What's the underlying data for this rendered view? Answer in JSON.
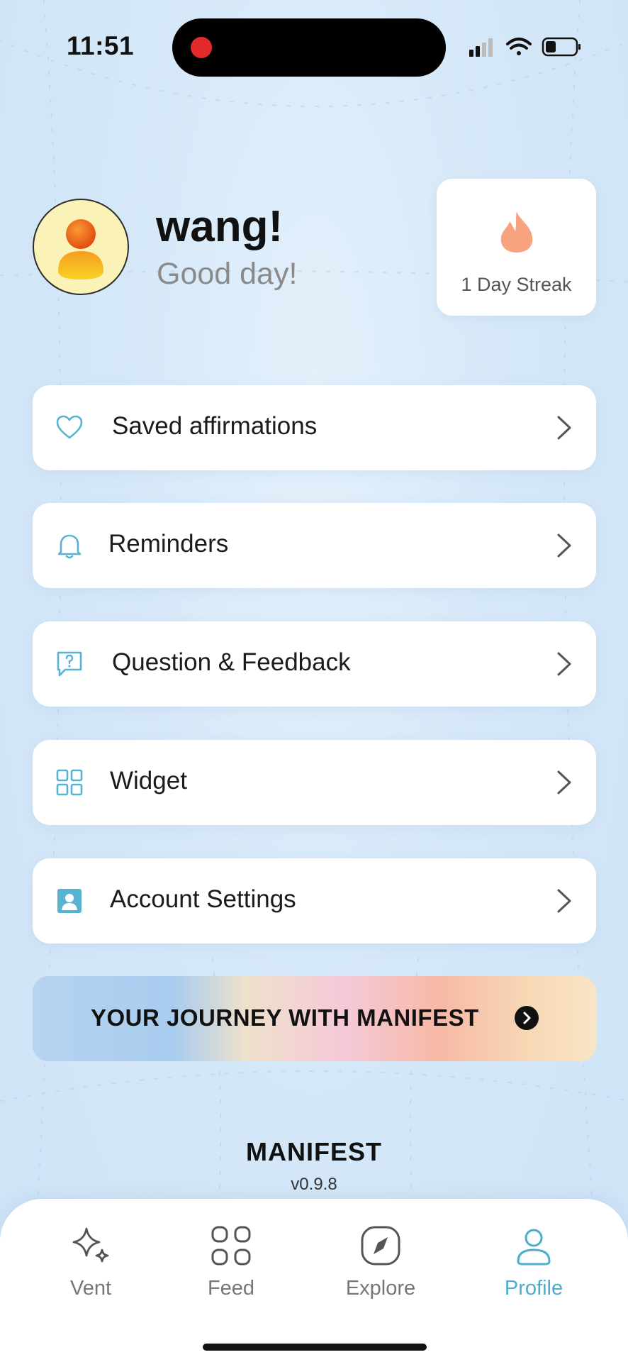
{
  "status_bar": {
    "time": "11:51"
  },
  "profile": {
    "username": "wang!",
    "greeting": "Good day!",
    "streak_label": "1 Day Streak"
  },
  "menu": [
    {
      "label": "Saved affirmations",
      "icon": "heart-icon"
    },
    {
      "label": "Reminders",
      "icon": "bell-icon"
    },
    {
      "label": "Question & Feedback",
      "icon": "question-chat-icon"
    },
    {
      "label": "Widget",
      "icon": "grid-icon"
    },
    {
      "label": "Account Settings",
      "icon": "account-card-icon"
    }
  ],
  "banner": {
    "label": "YOUR JOURNEY WITH MANIFEST"
  },
  "footer": {
    "brand": "MANIFEST",
    "version": "v0.9.8"
  },
  "tabs": [
    {
      "label": "Vent",
      "icon": "sparkle-icon"
    },
    {
      "label": "Feed",
      "icon": "grid-icon"
    },
    {
      "label": "Explore",
      "icon": "compass-icon"
    },
    {
      "label": "Profile",
      "icon": "person-icon",
      "active": true
    }
  ],
  "colors": {
    "accent": "#4baecc",
    "icon": "#58b3d3",
    "flame": "#f8a37f",
    "recording": "#e22a2a"
  }
}
